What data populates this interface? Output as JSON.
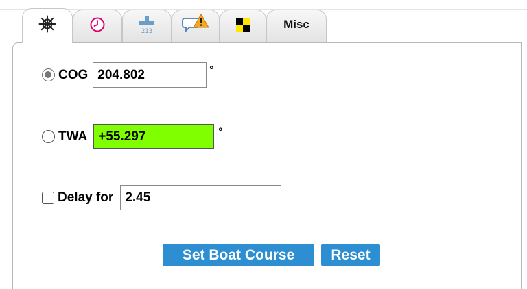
{
  "tabs": [
    {
      "icon": "helm-wheel-icon",
      "label": ""
    },
    {
      "icon": "clock-icon",
      "label": ""
    },
    {
      "icon": "altitude-213-icon",
      "label": "213"
    },
    {
      "icon": "chat-warning-icon",
      "label": ""
    },
    {
      "icon": "black-yellow-flag-icon",
      "label": ""
    },
    {
      "icon": "",
      "label": "Misc"
    }
  ],
  "form": {
    "cog": {
      "label": "COG",
      "value": "204.802",
      "unit": "°",
      "selected": true
    },
    "twa": {
      "label": "TWA",
      "value": "+55.297",
      "unit": "°",
      "selected": false
    },
    "delay": {
      "label": "Delay for",
      "value": "2.45",
      "checked": false
    }
  },
  "buttons": {
    "set_course": "Set Boat Course",
    "reset": "Reset"
  },
  "colors": {
    "twa_field_bg": "#80ff00",
    "button_bg": "#2d8fd2",
    "warning_orange": "#f5a623"
  }
}
